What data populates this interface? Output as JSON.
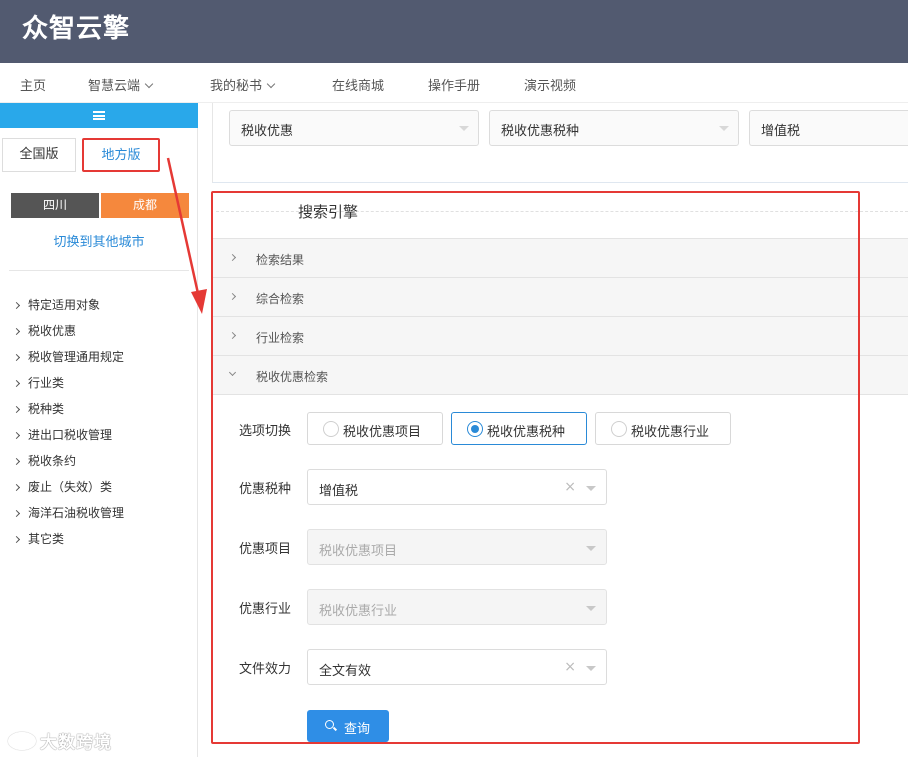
{
  "header": {
    "logo": "众智云擎"
  },
  "nav": {
    "items": [
      {
        "label": "主页",
        "dropdown": false
      },
      {
        "label": "智慧云端",
        "dropdown": true
      },
      {
        "label": "我的秘书",
        "dropdown": true
      },
      {
        "label": "在线商城",
        "dropdown": false
      },
      {
        "label": "操作手册",
        "dropdown": false
      },
      {
        "label": "演示视频",
        "dropdown": false
      }
    ]
  },
  "sidebar": {
    "toggle_icon": "menu-icon",
    "tabs": [
      {
        "label": "全国版",
        "active": false
      },
      {
        "label": "地方版",
        "active": true
      }
    ],
    "cities": [
      {
        "label": "四川",
        "active": false
      },
      {
        "label": "成都",
        "active": true
      }
    ],
    "switch_city": "切换到其他城市",
    "items": [
      "特定适用对象",
      "税收优惠",
      "税收管理通用规定",
      "行业类",
      "税种类",
      "进出口税收管理",
      "税收条约",
      "废止（失效）类",
      "海洋石油税收管理",
      "其它类"
    ]
  },
  "filters": [
    {
      "value": "税收优惠"
    },
    {
      "value": "税收优惠税种"
    },
    {
      "value": "增值税"
    }
  ],
  "search": {
    "title": "搜索引擎",
    "accordion": [
      {
        "label": "检索结果",
        "expanded": false
      },
      {
        "label": "综合检索",
        "expanded": false
      },
      {
        "label": "行业检索",
        "expanded": false
      },
      {
        "label": "税收优惠检索",
        "expanded": true
      }
    ],
    "form": {
      "option_label": "选项切换",
      "options": [
        {
          "label": "税收优惠项目",
          "selected": false
        },
        {
          "label": "税收优惠税种",
          "selected": true
        },
        {
          "label": "税收优惠行业",
          "selected": false
        }
      ],
      "tax_type_label": "优惠税种",
      "tax_type_value": "增值税",
      "project_label": "优惠项目",
      "project_placeholder": "税收优惠项目",
      "industry_label": "优惠行业",
      "industry_placeholder": "税收优惠行业",
      "validity_label": "文件效力",
      "validity_value": "全文有效",
      "query_button": "查询"
    }
  },
  "watermark": "大数跨境",
  "colors": {
    "header_bg": "#525a70",
    "accent_blue": "#2a8ad7",
    "sidebar_toggle": "#29a8ea",
    "city_dark": "#555555",
    "city_orange": "#f5883d",
    "annotation_red": "#e53935",
    "button_blue": "#2f8ee6"
  }
}
